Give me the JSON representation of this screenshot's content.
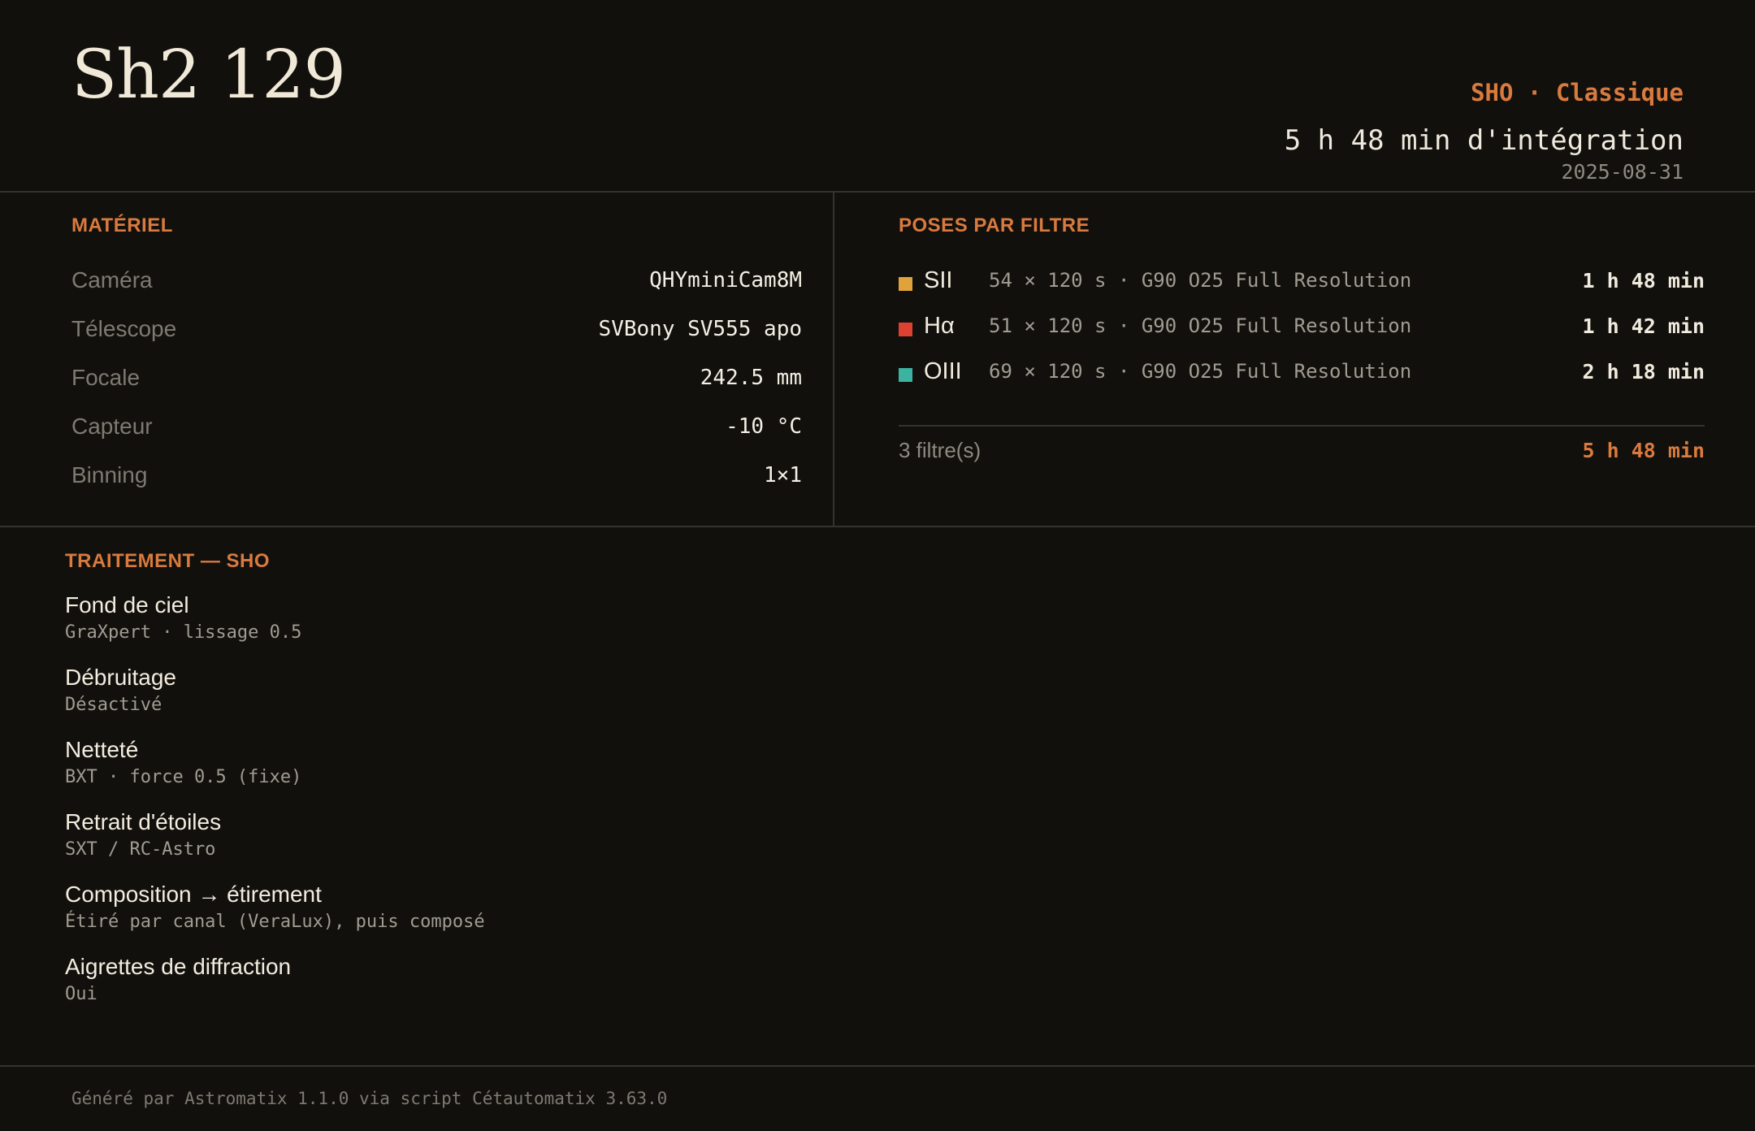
{
  "header": {
    "title": "Sh2 129",
    "mode": "SHO · Classique",
    "integration": "5 h 48 min d'intégration",
    "date": "2025-08-31"
  },
  "materiel": {
    "title": "MATÉRIEL",
    "rows": [
      {
        "label": "Caméra",
        "value": "QHYminiCam8M"
      },
      {
        "label": "Télescope",
        "value": "SVBony SV555 apo"
      },
      {
        "label": "Focale",
        "value": "242.5 mm"
      },
      {
        "label": "Capteur",
        "value": "-10 °C"
      },
      {
        "label": "Binning",
        "value": "1×1"
      }
    ]
  },
  "poses": {
    "title": "POSES PAR FILTRE",
    "filters": [
      {
        "name": "SII",
        "color": "#e0a23a",
        "detail": "54 × 120 s · G90 O25 Full Resolution",
        "duration": "1 h 48 min"
      },
      {
        "name": "Hα",
        "color": "#dd4132",
        "detail": "51 × 120 s · G90 O25 Full Resolution",
        "duration": "1 h 42 min"
      },
      {
        "name": "OIII",
        "color": "#3bb3a0",
        "detail": "69 × 120 s · G90 O25 Full Resolution",
        "duration": "2 h 18 min"
      }
    ],
    "count": "3 filtre(s)",
    "total": "5 h 48 min"
  },
  "traitement": {
    "title": "TRAITEMENT — SHO",
    "steps": [
      {
        "label": "Fond de ciel",
        "detail": "GraXpert · lissage 0.5"
      },
      {
        "label": "Débruitage",
        "detail": "Désactivé"
      },
      {
        "label": "Netteté",
        "detail": "BXT · force 0.5 (fixe)"
      },
      {
        "label": "Retrait d'étoiles",
        "detail": "SXT / RC-Astro"
      },
      {
        "label": "Composition → étirement",
        "detail": "Étiré par canal (VeraLux), puis composé"
      },
      {
        "label": "Aigrettes de diffraction",
        "detail": "Oui"
      }
    ]
  },
  "footer": {
    "text": "Généré par Astromatix 1.1.0 via script Cétautomatix 3.63.0"
  }
}
